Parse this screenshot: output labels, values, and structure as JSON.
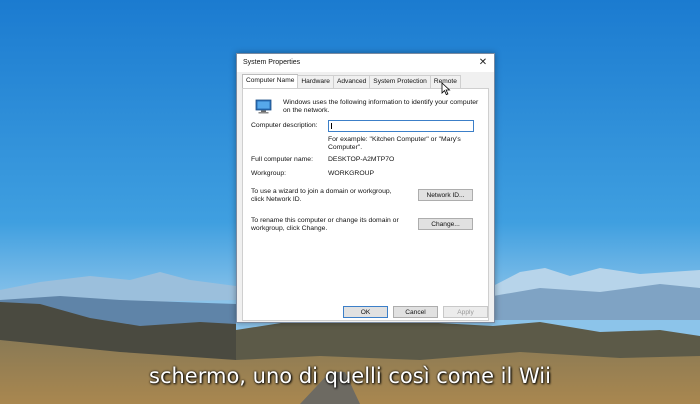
{
  "dialog": {
    "title": "System Properties",
    "close_glyph": "✕",
    "tabs": [
      {
        "label": "Computer Name",
        "active": true
      },
      {
        "label": "Hardware"
      },
      {
        "label": "Advanced"
      },
      {
        "label": "System Protection"
      },
      {
        "label": "Remote"
      }
    ],
    "intro": "Windows uses the following information to identify your computer on the network.",
    "description_label": "Computer description:",
    "description_value": "",
    "description_hint": "For example: \"Kitchen Computer\" or \"Mary's Computer\".",
    "full_name_label": "Full computer name:",
    "full_name_value": "DESKTOP-A2MTP7O",
    "workgroup_label": "Workgroup:",
    "workgroup_value": "WORKGROUP",
    "network_text": "To use a wizard to join a domain or workgroup, click Network ID.",
    "network_button": "Network ID...",
    "rename_text": "To rename this computer or change its domain or workgroup, click Change.",
    "change_button": "Change...",
    "ok_button": "OK",
    "cancel_button": "Cancel",
    "apply_button": "Apply"
  },
  "subtitle": "schermo, uno di quelli così come il Wii",
  "icons": {
    "computer": "computer-icon",
    "close": "close-icon",
    "cursor": "mouse-cursor-icon"
  }
}
